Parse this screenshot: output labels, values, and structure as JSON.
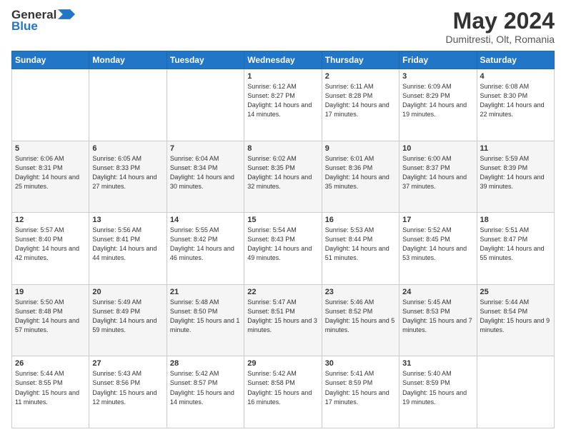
{
  "header": {
    "logo_line1": "General",
    "logo_line2": "Blue",
    "month_title": "May 2024",
    "location": "Dumitresti, Olt, Romania"
  },
  "days_of_week": [
    "Sunday",
    "Monday",
    "Tuesday",
    "Wednesday",
    "Thursday",
    "Friday",
    "Saturday"
  ],
  "weeks": [
    [
      {
        "day": "",
        "sunrise": "",
        "sunset": "",
        "daylight": ""
      },
      {
        "day": "",
        "sunrise": "",
        "sunset": "",
        "daylight": ""
      },
      {
        "day": "",
        "sunrise": "",
        "sunset": "",
        "daylight": ""
      },
      {
        "day": "1",
        "sunrise": "Sunrise: 6:12 AM",
        "sunset": "Sunset: 8:27 PM",
        "daylight": "Daylight: 14 hours and 14 minutes."
      },
      {
        "day": "2",
        "sunrise": "Sunrise: 6:11 AM",
        "sunset": "Sunset: 8:28 PM",
        "daylight": "Daylight: 14 hours and 17 minutes."
      },
      {
        "day": "3",
        "sunrise": "Sunrise: 6:09 AM",
        "sunset": "Sunset: 8:29 PM",
        "daylight": "Daylight: 14 hours and 19 minutes."
      },
      {
        "day": "4",
        "sunrise": "Sunrise: 6:08 AM",
        "sunset": "Sunset: 8:30 PM",
        "daylight": "Daylight: 14 hours and 22 minutes."
      }
    ],
    [
      {
        "day": "5",
        "sunrise": "Sunrise: 6:06 AM",
        "sunset": "Sunset: 8:31 PM",
        "daylight": "Daylight: 14 hours and 25 minutes."
      },
      {
        "day": "6",
        "sunrise": "Sunrise: 6:05 AM",
        "sunset": "Sunset: 8:33 PM",
        "daylight": "Daylight: 14 hours and 27 minutes."
      },
      {
        "day": "7",
        "sunrise": "Sunrise: 6:04 AM",
        "sunset": "Sunset: 8:34 PM",
        "daylight": "Daylight: 14 hours and 30 minutes."
      },
      {
        "day": "8",
        "sunrise": "Sunrise: 6:02 AM",
        "sunset": "Sunset: 8:35 PM",
        "daylight": "Daylight: 14 hours and 32 minutes."
      },
      {
        "day": "9",
        "sunrise": "Sunrise: 6:01 AM",
        "sunset": "Sunset: 8:36 PM",
        "daylight": "Daylight: 14 hours and 35 minutes."
      },
      {
        "day": "10",
        "sunrise": "Sunrise: 6:00 AM",
        "sunset": "Sunset: 8:37 PM",
        "daylight": "Daylight: 14 hours and 37 minutes."
      },
      {
        "day": "11",
        "sunrise": "Sunrise: 5:59 AM",
        "sunset": "Sunset: 8:39 PM",
        "daylight": "Daylight: 14 hours and 39 minutes."
      }
    ],
    [
      {
        "day": "12",
        "sunrise": "Sunrise: 5:57 AM",
        "sunset": "Sunset: 8:40 PM",
        "daylight": "Daylight: 14 hours and 42 minutes."
      },
      {
        "day": "13",
        "sunrise": "Sunrise: 5:56 AM",
        "sunset": "Sunset: 8:41 PM",
        "daylight": "Daylight: 14 hours and 44 minutes."
      },
      {
        "day": "14",
        "sunrise": "Sunrise: 5:55 AM",
        "sunset": "Sunset: 8:42 PM",
        "daylight": "Daylight: 14 hours and 46 minutes."
      },
      {
        "day": "15",
        "sunrise": "Sunrise: 5:54 AM",
        "sunset": "Sunset: 8:43 PM",
        "daylight": "Daylight: 14 hours and 49 minutes."
      },
      {
        "day": "16",
        "sunrise": "Sunrise: 5:53 AM",
        "sunset": "Sunset: 8:44 PM",
        "daylight": "Daylight: 14 hours and 51 minutes."
      },
      {
        "day": "17",
        "sunrise": "Sunrise: 5:52 AM",
        "sunset": "Sunset: 8:45 PM",
        "daylight": "Daylight: 14 hours and 53 minutes."
      },
      {
        "day": "18",
        "sunrise": "Sunrise: 5:51 AM",
        "sunset": "Sunset: 8:47 PM",
        "daylight": "Daylight: 14 hours and 55 minutes."
      }
    ],
    [
      {
        "day": "19",
        "sunrise": "Sunrise: 5:50 AM",
        "sunset": "Sunset: 8:48 PM",
        "daylight": "Daylight: 14 hours and 57 minutes."
      },
      {
        "day": "20",
        "sunrise": "Sunrise: 5:49 AM",
        "sunset": "Sunset: 8:49 PM",
        "daylight": "Daylight: 14 hours and 59 minutes."
      },
      {
        "day": "21",
        "sunrise": "Sunrise: 5:48 AM",
        "sunset": "Sunset: 8:50 PM",
        "daylight": "Daylight: 15 hours and 1 minute."
      },
      {
        "day": "22",
        "sunrise": "Sunrise: 5:47 AM",
        "sunset": "Sunset: 8:51 PM",
        "daylight": "Daylight: 15 hours and 3 minutes."
      },
      {
        "day": "23",
        "sunrise": "Sunrise: 5:46 AM",
        "sunset": "Sunset: 8:52 PM",
        "daylight": "Daylight: 15 hours and 5 minutes."
      },
      {
        "day": "24",
        "sunrise": "Sunrise: 5:45 AM",
        "sunset": "Sunset: 8:53 PM",
        "daylight": "Daylight: 15 hours and 7 minutes."
      },
      {
        "day": "25",
        "sunrise": "Sunrise: 5:44 AM",
        "sunset": "Sunset: 8:54 PM",
        "daylight": "Daylight: 15 hours and 9 minutes."
      }
    ],
    [
      {
        "day": "26",
        "sunrise": "Sunrise: 5:44 AM",
        "sunset": "Sunset: 8:55 PM",
        "daylight": "Daylight: 15 hours and 11 minutes."
      },
      {
        "day": "27",
        "sunrise": "Sunrise: 5:43 AM",
        "sunset": "Sunset: 8:56 PM",
        "daylight": "Daylight: 15 hours and 12 minutes."
      },
      {
        "day": "28",
        "sunrise": "Sunrise: 5:42 AM",
        "sunset": "Sunset: 8:57 PM",
        "daylight": "Daylight: 15 hours and 14 minutes."
      },
      {
        "day": "29",
        "sunrise": "Sunrise: 5:42 AM",
        "sunset": "Sunset: 8:58 PM",
        "daylight": "Daylight: 15 hours and 16 minutes."
      },
      {
        "day": "30",
        "sunrise": "Sunrise: 5:41 AM",
        "sunset": "Sunset: 8:59 PM",
        "daylight": "Daylight: 15 hours and 17 minutes."
      },
      {
        "day": "31",
        "sunrise": "Sunrise: 5:40 AM",
        "sunset": "Sunset: 8:59 PM",
        "daylight": "Daylight: 15 hours and 19 minutes."
      },
      {
        "day": "",
        "sunrise": "",
        "sunset": "",
        "daylight": ""
      }
    ]
  ]
}
